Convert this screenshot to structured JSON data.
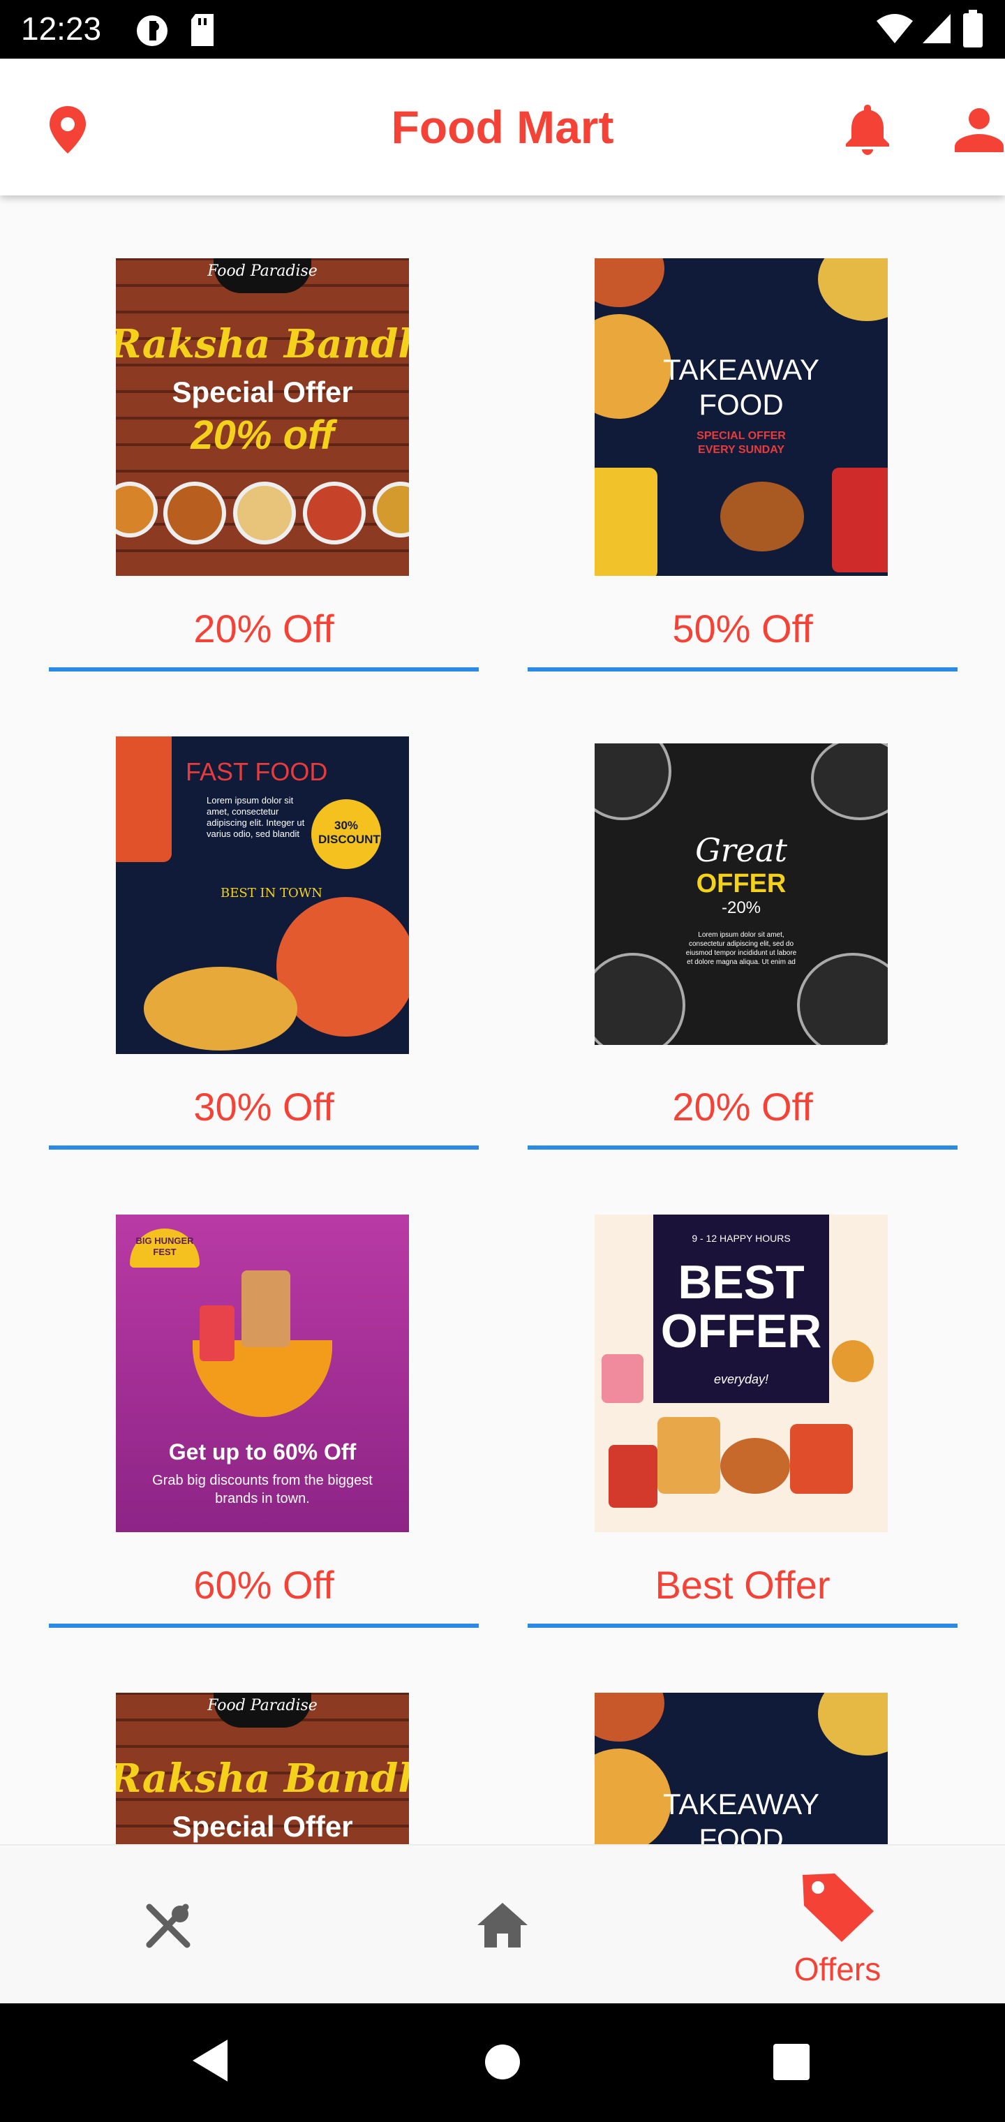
{
  "status_bar": {
    "time": "12:23"
  },
  "app_bar": {
    "title": "Food Mart"
  },
  "offers": [
    {
      "label": "20% Off",
      "poster": {
        "brand": "Food Paradise",
        "headline": "Raksha Bandhan",
        "line1": "Special Offer",
        "line2": "20% off"
      }
    },
    {
      "label": "50% Off",
      "poster": {
        "line1": "TAKEAWAY",
        "line2": "FOOD",
        "line3": "SPECIAL OFFER",
        "line4": "EVERY SUNDAY"
      }
    },
    {
      "label": "30% Off",
      "poster": {
        "line1": "FAST FOOD",
        "line2": "Lorem ipsum dolor sit amet, consectetur adipiscing elit. Integer ut varius odio, sed blandit",
        "badge": "30% DISCOUNT",
        "line3": "BEST IN TOWN"
      }
    },
    {
      "label": "20% Off",
      "poster": {
        "line1": "Great",
        "line2": "OFFER",
        "line3": "-20%",
        "line4": "Lorem ipsum dolor sit amet, consectetur adipiscing elit, sed do eiusmod tempor incididunt ut labore et dolore magna aliqua. Ut enim ad"
      }
    },
    {
      "label": "60% Off",
      "poster": {
        "badge": "BIG HUNGER FEST",
        "line1": "Get up to 60% Off",
        "line2": "Grab big discounts from the biggest brands in town."
      }
    },
    {
      "label": "Best Offer",
      "poster": {
        "line0": "9 - 12 HAPPY HOURS",
        "line1": "BEST",
        "line2": "OFFER",
        "line3": "everyday!"
      }
    },
    {
      "label": "20% Off",
      "poster": {
        "brand": "Food Paradise",
        "headline": "Raksha Bandhan",
        "line1": "Special Offer"
      }
    },
    {
      "label": "50% Off",
      "poster": {
        "line1": "TAKEAWAY",
        "line2": "FOOD"
      }
    }
  ],
  "bottom_nav": {
    "offers_label": "Offers"
  },
  "colors": {
    "accent": "#f44336",
    "divider": "#2b8ae6",
    "icon_gray": "#5f5f5f"
  },
  "icons": [
    "location-pin-icon",
    "bell-icon",
    "person-icon",
    "restaurant-icon",
    "home-icon",
    "tag-icon",
    "back-icon",
    "home-circle-icon",
    "recents-square-icon"
  ]
}
